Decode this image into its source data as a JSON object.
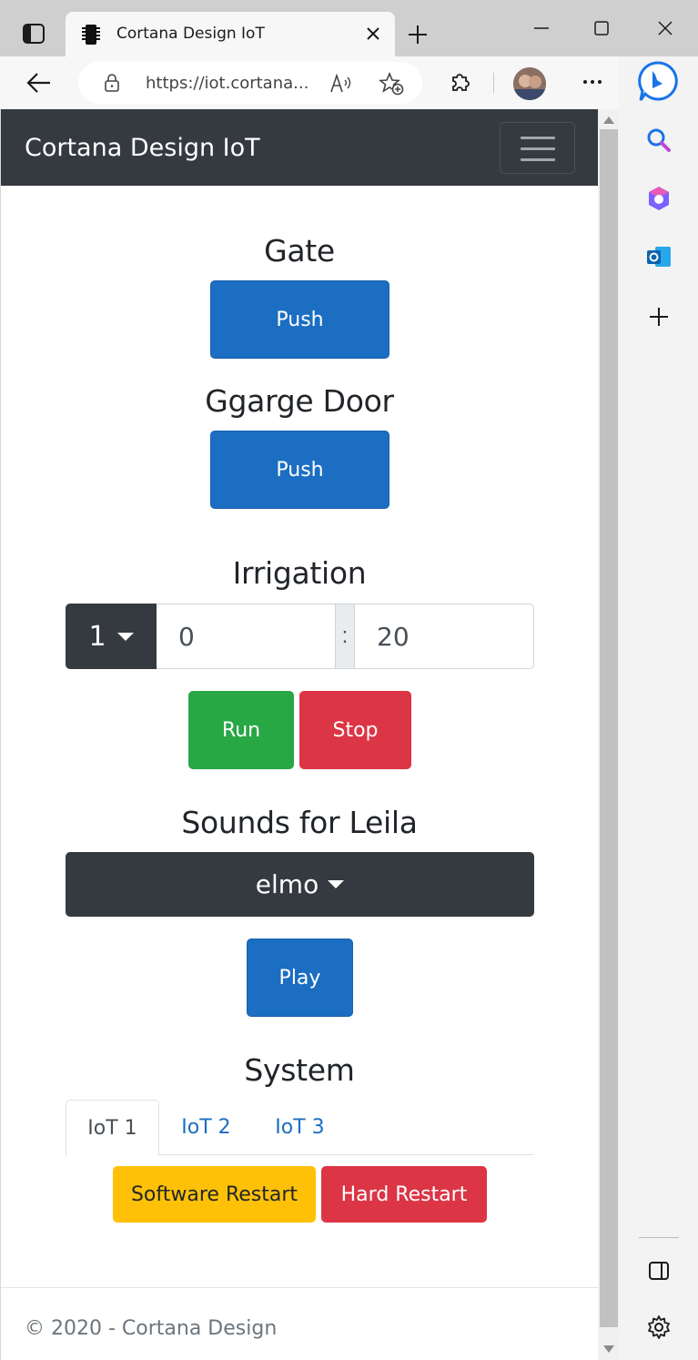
{
  "browser": {
    "tab_title": "Cortana Design IoT",
    "url": "https://iot.cortana...",
    "new_tab_icon": "plus-icon",
    "window_controls": [
      "minimize-icon",
      "maximize-icon",
      "close-icon"
    ],
    "sidebar_icons": [
      "search-icon",
      "office-icon",
      "outlook-icon",
      "add-icon",
      "sidebar-toggle-icon",
      "settings-icon"
    ]
  },
  "navbar": {
    "brand": "Cortana Design IoT"
  },
  "gate": {
    "title": "Gate",
    "button": "Push"
  },
  "garage": {
    "title": "Ggarge Door",
    "button": "Push"
  },
  "irrigation": {
    "title": "Irrigation",
    "zone": "1",
    "minutes": "0",
    "separator": ":",
    "seconds": "20",
    "run": "Run",
    "stop": "Stop"
  },
  "sounds": {
    "title": "Sounds for Leila",
    "selected": "elmo",
    "play": "Play"
  },
  "system": {
    "title": "System",
    "tabs": [
      "IoT 1",
      "IoT 2",
      "IoT 3"
    ],
    "active_tab": "IoT 1",
    "soft_restart": "Software Restart",
    "hard_restart": "Hard Restart"
  },
  "footer": {
    "text": "© 2020 - Cortana Design"
  },
  "colors": {
    "navbar": "#343a40",
    "primary": "#1b6ec2",
    "success": "#28a745",
    "danger": "#dc3545",
    "warning": "#ffc107"
  }
}
